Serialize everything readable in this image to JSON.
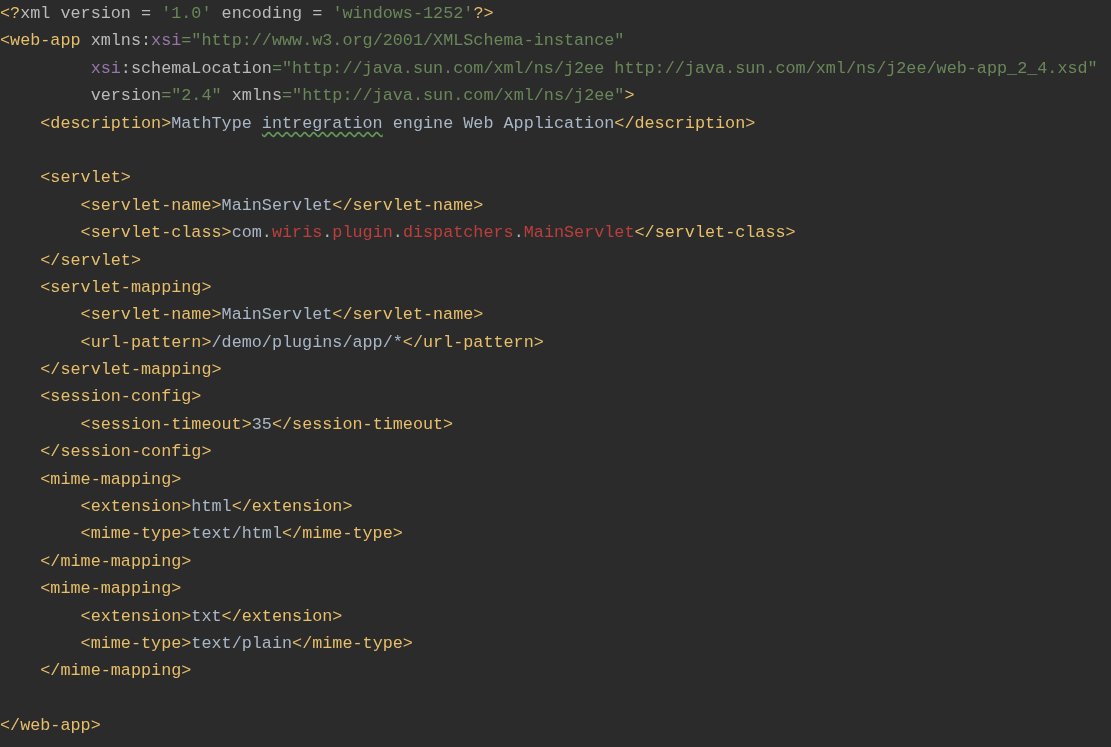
{
  "editor": {
    "lines": [
      {
        "tokens": [
          {
            "kind": "tag",
            "text": "<?"
          },
          {
            "kind": "plain",
            "text": "xml version = "
          },
          {
            "kind": "str",
            "text": "'1.0'"
          },
          {
            "kind": "plain",
            "text": " encoding = "
          },
          {
            "kind": "str",
            "text": "'windows-1252'"
          },
          {
            "kind": "tag",
            "text": "?>"
          }
        ]
      },
      {
        "tokens": [
          {
            "kind": "tag",
            "text": "<web-app"
          },
          {
            "kind": "plain",
            "text": " xmlns:"
          },
          {
            "kind": "ns",
            "text": "xsi"
          },
          {
            "kind": "str",
            "text": "=\"http://www.w3.org/2001/XMLSchema-instance\""
          }
        ]
      },
      {
        "tokens": [
          {
            "kind": "ns",
            "text": "         xsi"
          },
          {
            "kind": "plain",
            "text": ":schemaLocation"
          },
          {
            "kind": "str",
            "text": "=\"http://java.sun.com/xml/ns/j2ee http://java.sun.com/xml/ns/j2ee/web-app_2_4.xsd\""
          }
        ]
      },
      {
        "tokens": [
          {
            "kind": "plain",
            "text": "         version"
          },
          {
            "kind": "str",
            "text": "=\"2.4\""
          },
          {
            "kind": "plain",
            "text": " xmlns"
          },
          {
            "kind": "str",
            "text": "=\"http://java.sun.com/xml/ns/j2ee\""
          },
          {
            "kind": "tag",
            "text": ">"
          }
        ]
      },
      {
        "tokens": [
          {
            "kind": "tag",
            "text": "    <description>"
          },
          {
            "kind": "text",
            "text": "MathType "
          },
          {
            "kind": "typo",
            "text": "intregration"
          },
          {
            "kind": "text",
            "text": " engine Web Application"
          },
          {
            "kind": "tag",
            "text": "</description>"
          }
        ]
      },
      {
        "kind": "blank"
      },
      {
        "tokens": [
          {
            "kind": "tag",
            "text": "    <servlet>"
          }
        ]
      },
      {
        "tokens": [
          {
            "kind": "tag",
            "text": "        <servlet-name>"
          },
          {
            "kind": "text",
            "text": "MainServlet"
          },
          {
            "kind": "tag",
            "text": "</servlet-name>"
          }
        ]
      },
      {
        "tokens": [
          {
            "kind": "tag",
            "text": "        <servlet-class>"
          },
          {
            "kind": "text",
            "text": "com."
          },
          {
            "kind": "ref",
            "text": "wiris"
          },
          {
            "kind": "text",
            "text": "."
          },
          {
            "kind": "ref",
            "text": "plugin"
          },
          {
            "kind": "text",
            "text": "."
          },
          {
            "kind": "ref",
            "text": "dispatchers"
          },
          {
            "kind": "text",
            "text": "."
          },
          {
            "kind": "ref",
            "text": "MainServlet"
          },
          {
            "kind": "tag",
            "text": "</servlet-class>"
          }
        ]
      },
      {
        "tokens": [
          {
            "kind": "tag",
            "text": "    </servlet>"
          }
        ]
      },
      {
        "tokens": [
          {
            "kind": "tag",
            "text": "    <servlet-mapping>"
          }
        ]
      },
      {
        "tokens": [
          {
            "kind": "tag",
            "text": "        <servlet-name>"
          },
          {
            "kind": "text",
            "text": "MainServlet"
          },
          {
            "kind": "tag",
            "text": "</servlet-name>"
          }
        ]
      },
      {
        "tokens": [
          {
            "kind": "tag",
            "text": "        <url-pattern>"
          },
          {
            "kind": "text",
            "text": "/demo/plugins/app/*"
          },
          {
            "kind": "tag",
            "text": "</url-pattern>"
          }
        ]
      },
      {
        "tokens": [
          {
            "kind": "tag",
            "text": "    </servlet-mapping>"
          }
        ]
      },
      {
        "tokens": [
          {
            "kind": "tag",
            "text": "    <session-config>"
          }
        ]
      },
      {
        "tokens": [
          {
            "kind": "tag",
            "text": "        <session-timeout>"
          },
          {
            "kind": "text",
            "text": "35"
          },
          {
            "kind": "tag",
            "text": "</session-timeout>"
          }
        ]
      },
      {
        "tokens": [
          {
            "kind": "tag",
            "text": "    </session-config>"
          }
        ]
      },
      {
        "tokens": [
          {
            "kind": "tag",
            "text": "    <mime-mapping>"
          }
        ]
      },
      {
        "tokens": [
          {
            "kind": "tag",
            "text": "        <extension>"
          },
          {
            "kind": "text",
            "text": "html"
          },
          {
            "kind": "tag",
            "text": "</extension>"
          }
        ]
      },
      {
        "tokens": [
          {
            "kind": "tag",
            "text": "        <mime-type>"
          },
          {
            "kind": "text",
            "text": "text/html"
          },
          {
            "kind": "tag",
            "text": "</mime-type>"
          }
        ]
      },
      {
        "tokens": [
          {
            "kind": "tag",
            "text": "    </mime-mapping>"
          }
        ]
      },
      {
        "tokens": [
          {
            "kind": "tag",
            "text": "    <mime-mapping>"
          }
        ]
      },
      {
        "tokens": [
          {
            "kind": "tag",
            "text": "        <extension>"
          },
          {
            "kind": "text",
            "text": "txt"
          },
          {
            "kind": "tag",
            "text": "</extension>"
          }
        ]
      },
      {
        "tokens": [
          {
            "kind": "tag",
            "text": "        <mime-type>"
          },
          {
            "kind": "text",
            "text": "text/plain"
          },
          {
            "kind": "tag",
            "text": "</mime-type>"
          }
        ]
      },
      {
        "tokens": [
          {
            "kind": "tag",
            "text": "    </mime-mapping>"
          }
        ]
      },
      {
        "kind": "blank"
      },
      {
        "tokens": [
          {
            "kind": "tag",
            "text": "</web-app>"
          }
        ]
      }
    ]
  }
}
